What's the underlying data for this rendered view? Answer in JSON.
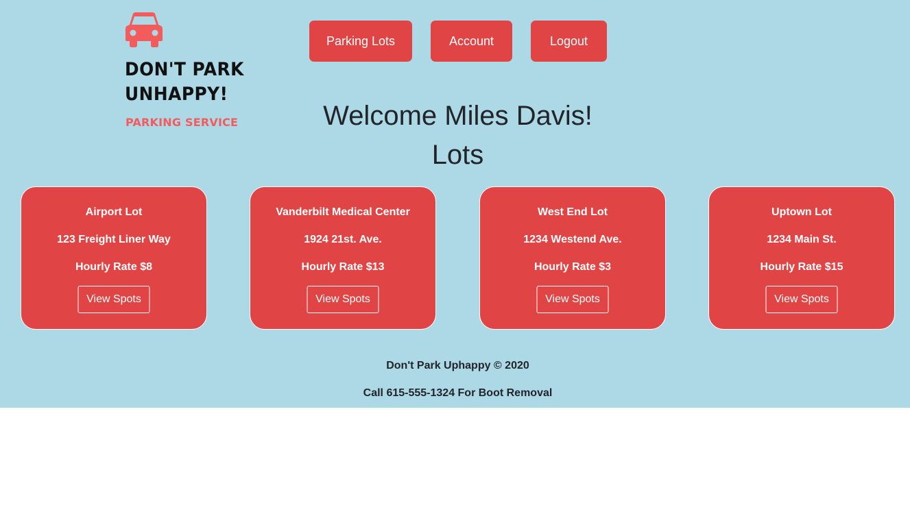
{
  "brand": {
    "logo_line1": "DON'T PARK",
    "logo_line2": "UNHAPPY!",
    "tagline": "PARKING SERVICE",
    "accent_color": "#f25c5c"
  },
  "nav": {
    "items": [
      {
        "label": "Parking Lots"
      },
      {
        "label": "Account"
      },
      {
        "label": "Logout"
      }
    ]
  },
  "main": {
    "welcome": "Welcome Miles Davis!",
    "section_title": "Lots",
    "lots": [
      {
        "name": "Airport Lot",
        "address": "123 Freight Liner Way",
        "rate": "Hourly Rate $8",
        "button": "View Spots"
      },
      {
        "name": "Vanderbilt Medical Center",
        "address": "1924 21st. Ave.",
        "rate": "Hourly Rate $13",
        "button": "View Spots"
      },
      {
        "name": "West End Lot",
        "address": "1234 Westend Ave.",
        "rate": "Hourly Rate $3",
        "button": "View Spots"
      },
      {
        "name": "Uptown Lot",
        "address": "1234 Main St.",
        "rate": "Hourly Rate $15",
        "button": "View Spots"
      }
    ]
  },
  "footer": {
    "copyright": "Don't Park Uphappy © 2020",
    "call": "Call 615-555-1324 For Boot Removal"
  },
  "colors": {
    "page_background": "#add8e6",
    "card_background": "#e04444",
    "nav_button": "#e04444"
  }
}
